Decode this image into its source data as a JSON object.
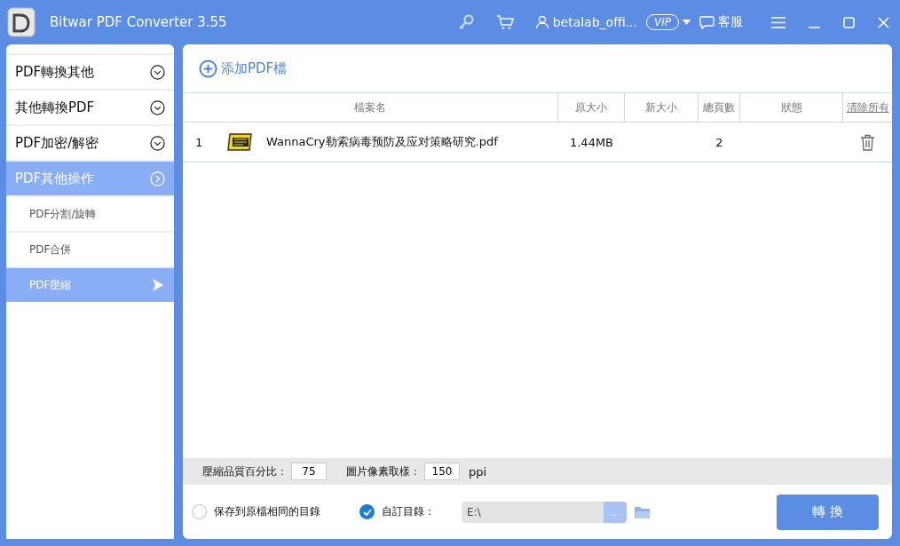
{
  "window": {
    "title": "Bitwar PDF Converter 3.55"
  },
  "account": {
    "user": "betalab_offi...",
    "badge": "VIP",
    "service": "客服"
  },
  "sidebar": {
    "items": [
      {
        "label": "PDF轉換其他",
        "selected": false,
        "expanded": false
      },
      {
        "label": "其他轉換PDF",
        "selected": false,
        "expanded": false
      },
      {
        "label": "PDF加密/解密",
        "selected": false,
        "expanded": false
      },
      {
        "label": "PDF其他操作",
        "selected": true,
        "expanded": true,
        "children": [
          {
            "label": "PDF分割/旋轉",
            "selected": false
          },
          {
            "label": "PDF合併",
            "selected": false
          },
          {
            "label": "PDF壓縮",
            "selected": true
          }
        ]
      }
    ]
  },
  "add_button": {
    "label": "添加PDF檔"
  },
  "table": {
    "columns": [
      "檔案名",
      "原大小",
      "新大小",
      "總頁數",
      "狀態"
    ],
    "clear_all": "清除所有",
    "rows": [
      {
        "index": "1",
        "name": "WannaCry勒索病毒预防及应对策略研究.pdf",
        "original_size": "1.44MB",
        "pages": "2"
      }
    ]
  },
  "settings": {
    "quality_label": "壓縮品質百分比：",
    "quality": "75",
    "sampling_label": "圖片像素取樣：",
    "sampling": "150",
    "unit": "ppi"
  },
  "output": {
    "options": [
      {
        "label": "保存到原檔相同的目錄",
        "selected": false
      },
      {
        "label": "自訂目錄：",
        "selected": true
      }
    ],
    "path": "E:\\",
    "browse": "...",
    "convert": "轉 換"
  }
}
